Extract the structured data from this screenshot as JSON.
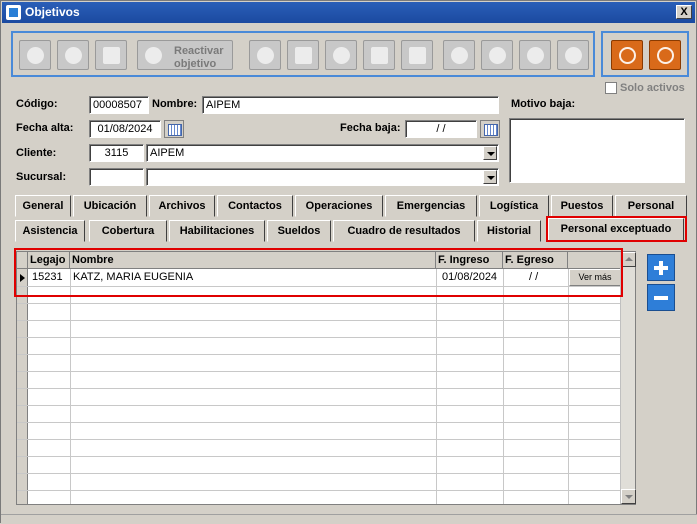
{
  "window": {
    "title": "Objetivos",
    "close_label": "X"
  },
  "toolbar": {
    "reactivar_line1": "Reactivar",
    "reactivar_line2": "objetivo"
  },
  "solo_activos": {
    "label": "Solo activos",
    "checked": false
  },
  "form": {
    "codigo_label": "Código:",
    "codigo_value": "00008507",
    "nombre_label": "Nombre:",
    "nombre_value": "AIPEM",
    "motivo_baja_label": "Motivo baja:",
    "motivo_baja_value": "",
    "fecha_alta_label": "Fecha alta:",
    "fecha_alta_value": "01/08/2024",
    "fecha_baja_label": "Fecha baja:",
    "fecha_baja_value": "  /  /",
    "cliente_label": "Cliente:",
    "cliente_code": "3115",
    "cliente_name": "AIPEM",
    "sucursal_label": "Sucursal:",
    "sucursal_code": "",
    "sucursal_name": ""
  },
  "tabs_row1": [
    "General",
    "Ubicación",
    "Archivos",
    "Contactos",
    "Operaciones",
    "Emergencias",
    "Logística",
    "Puestos",
    "Personal"
  ],
  "tabs_row2": [
    "Asistencia",
    "Cobertura",
    "Habilitaciones",
    "Sueldos",
    "Cuadro de resultados",
    "Historial",
    "Personal exceptuado"
  ],
  "active_tab": "Personal exceptuado",
  "grid": {
    "columns": [
      "Legajo",
      "Nombre",
      "F. Ingreso",
      "F. Egreso",
      ""
    ],
    "rows": [
      {
        "legajo": "15231",
        "nombre": "KATZ, MARIA EUGENIA",
        "f_ingreso": "01/08/2024",
        "f_egreso": " /  /",
        "action": "Ver más"
      }
    ]
  },
  "colors": {
    "highlight": "#e00000",
    "title_bar": "#2a5fb8",
    "accent_blue": "#2e7ed8",
    "accent_orange": "#d96a1a"
  }
}
